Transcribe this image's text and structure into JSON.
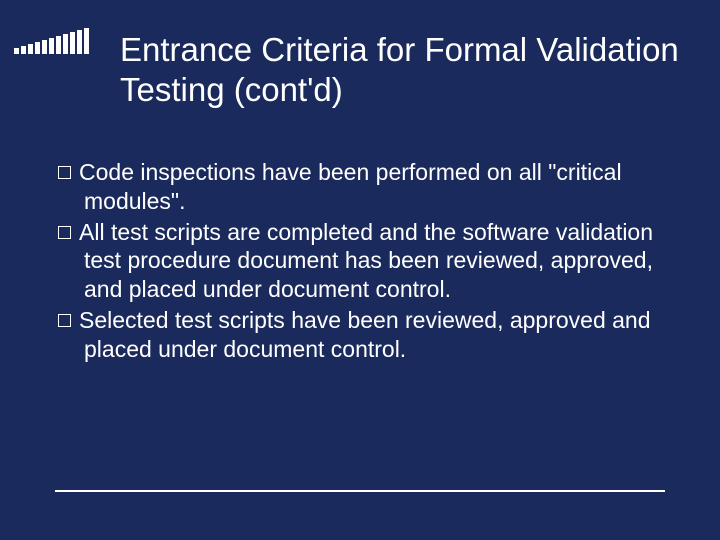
{
  "title": "Entrance Criteria for Formal Validation Testing (cont'd)",
  "bullets": [
    "Code inspections have been performed on all \"critical modules\".",
    "All test scripts are completed and the software validation test procedure document has been reviewed, approved, and placed under document control.",
    "Selected test scripts have been reviewed, approved and placed under document control."
  ]
}
